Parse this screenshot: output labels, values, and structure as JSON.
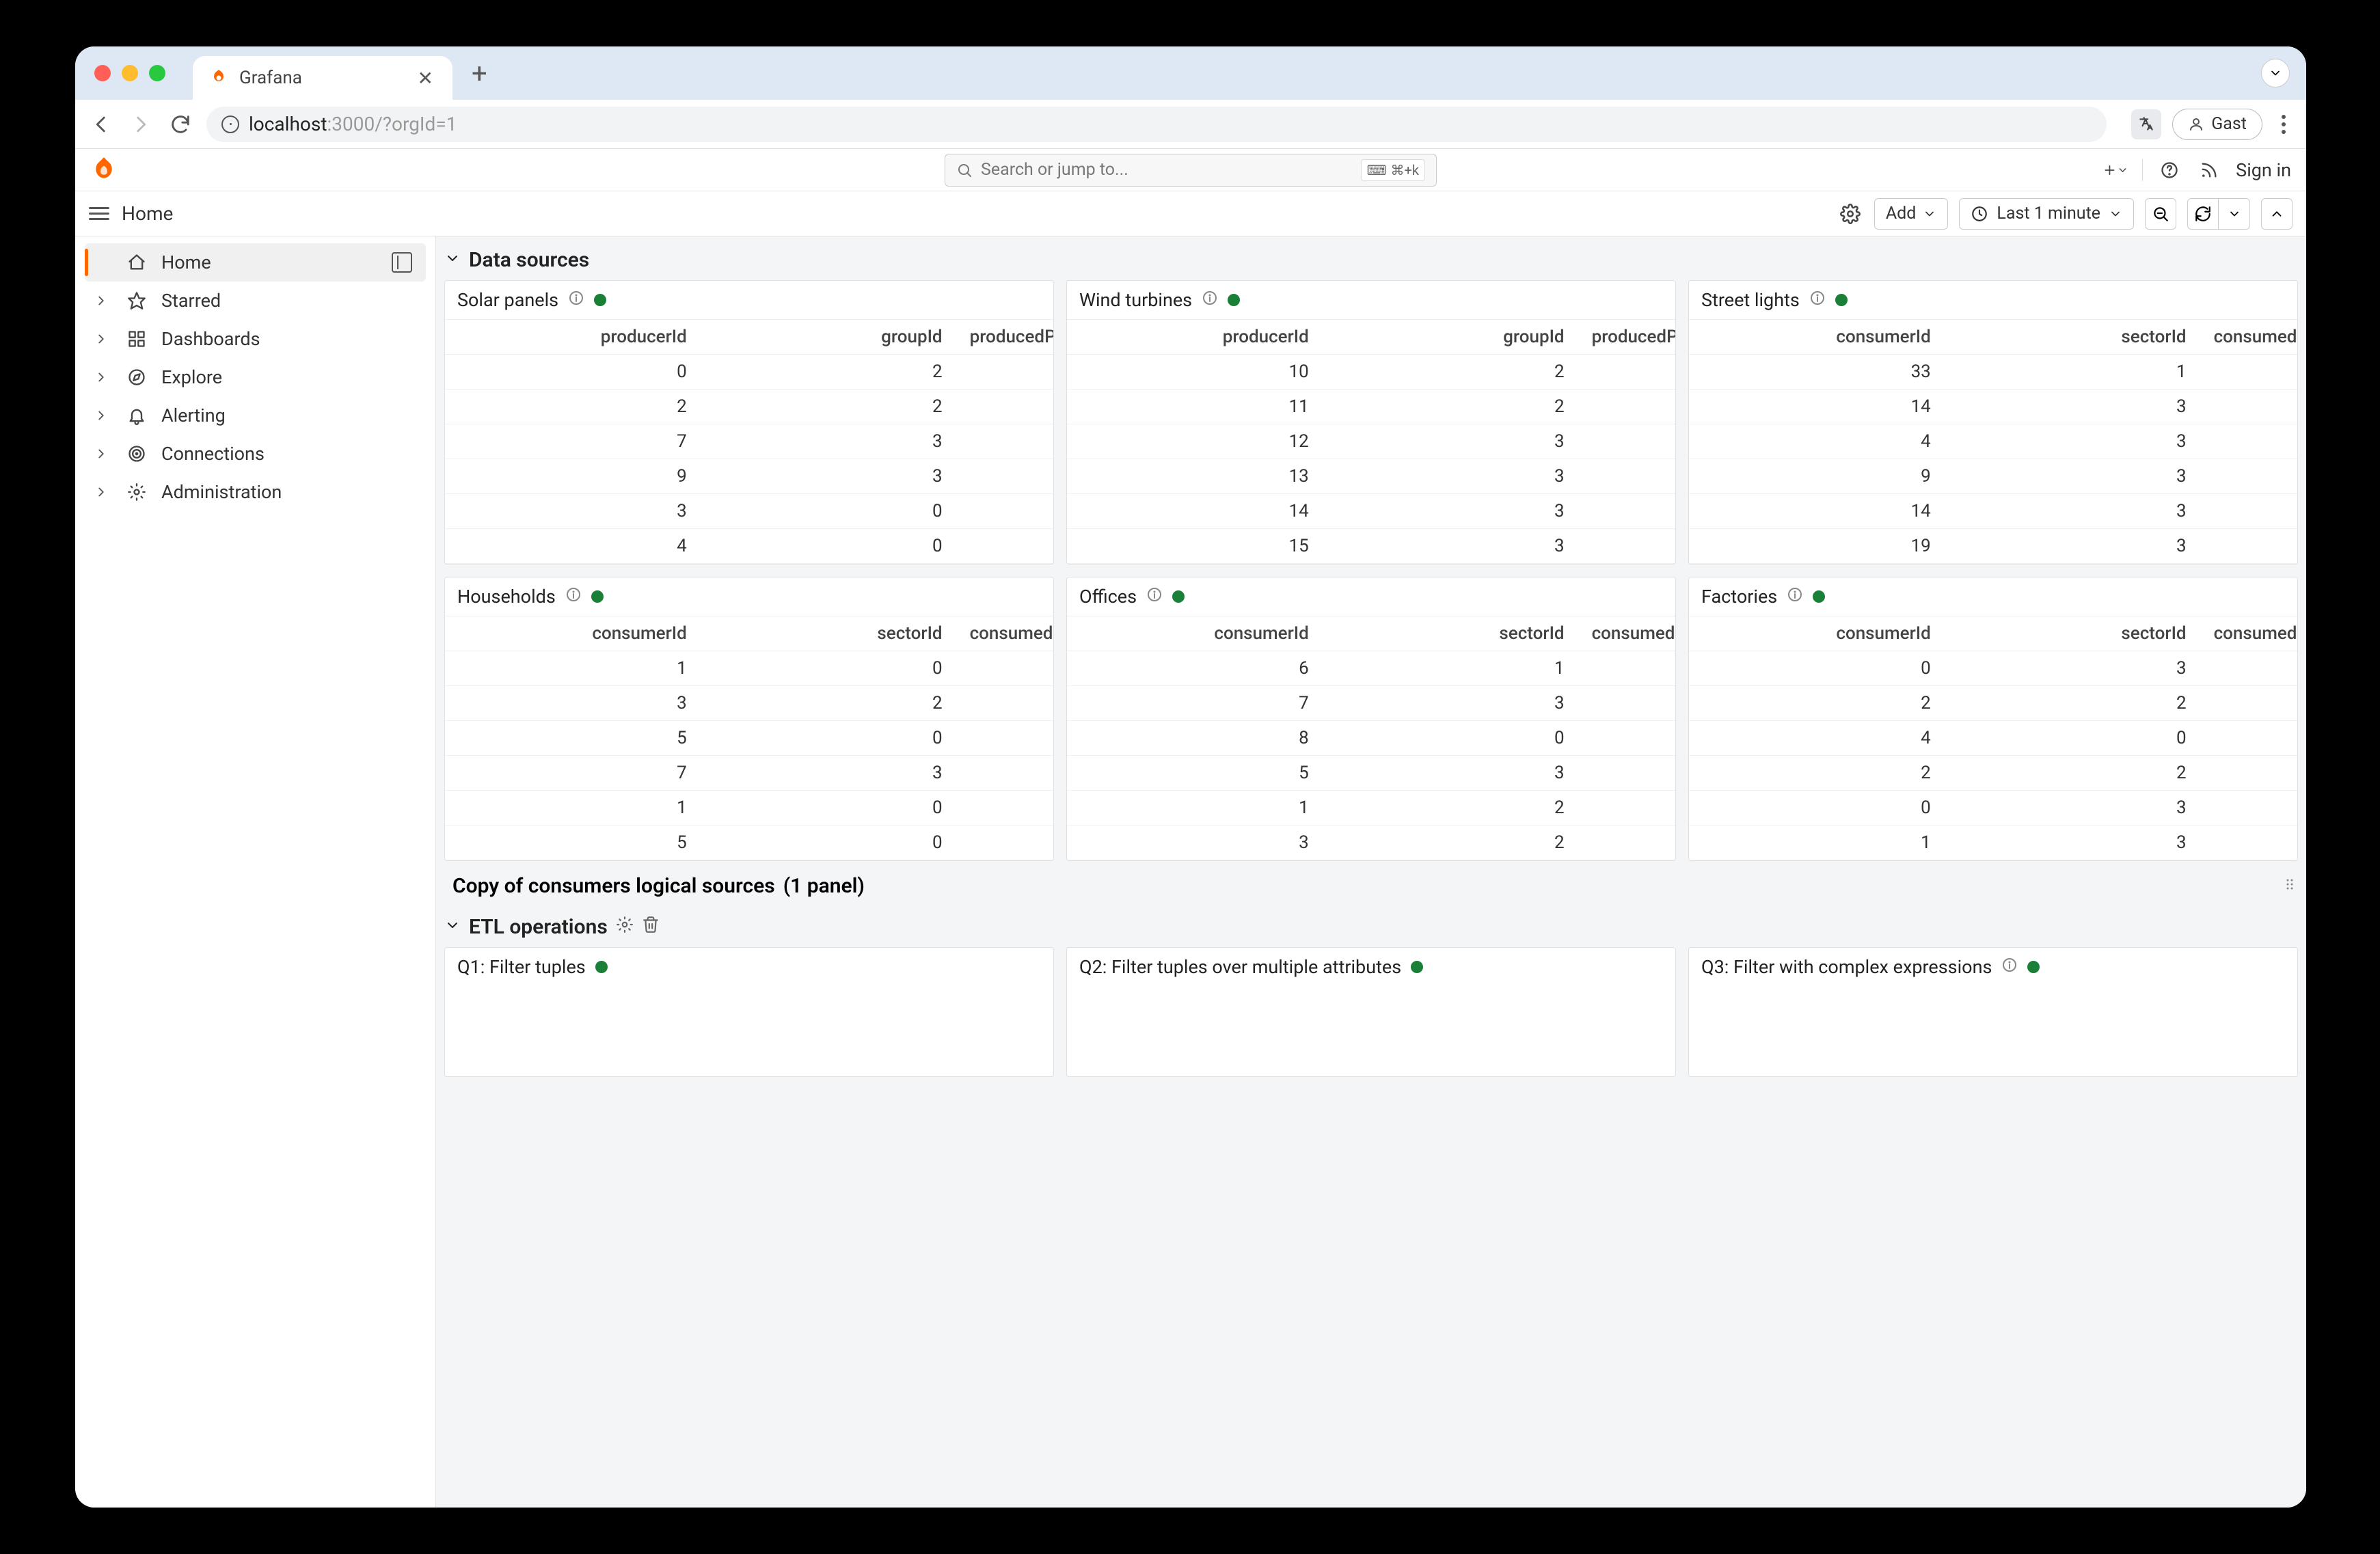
{
  "browser": {
    "tab_title": "Grafana",
    "url_host": "localhost",
    "url_rest": ":3000/?orgId=1",
    "profile_label": "Gast"
  },
  "grafana_top": {
    "search_placeholder": "Search or jump to...",
    "kbd1_icon": "⌨",
    "kbd2": "⌘+k",
    "signin": "Sign in"
  },
  "sub_toolbar": {
    "breadcrumb": "Home",
    "add_label": "Add",
    "time_label": "Last 1 minute"
  },
  "sidebar": {
    "items": [
      {
        "label": "Home",
        "icon": "home",
        "active": true,
        "expandable": false,
        "collapse_btn": true
      },
      {
        "label": "Starred",
        "icon": "star",
        "active": false,
        "expandable": true
      },
      {
        "label": "Dashboards",
        "icon": "grid",
        "active": false,
        "expandable": true
      },
      {
        "label": "Explore",
        "icon": "compass",
        "active": false,
        "expandable": true
      },
      {
        "label": "Alerting",
        "icon": "bell",
        "active": false,
        "expandable": true
      },
      {
        "label": "Connections",
        "icon": "target",
        "active": false,
        "expandable": true
      },
      {
        "label": "Administration",
        "icon": "gear",
        "active": false,
        "expandable": true
      }
    ]
  },
  "rows": {
    "data_sources_title": "Data sources",
    "copy_row_title": "Copy of consumers logical sources",
    "copy_row_sub": "(1 panel)",
    "etl_title": "ETL operations"
  },
  "panels": [
    {
      "title": "Solar panels",
      "columns": [
        "producerId",
        "groupId",
        "producedP"
      ],
      "rows": [
        [
          "0",
          "2",
          ""
        ],
        [
          "2",
          "2",
          ""
        ],
        [
          "7",
          "3",
          ""
        ],
        [
          "9",
          "3",
          ""
        ],
        [
          "3",
          "0",
          ""
        ],
        [
          "4",
          "0",
          ""
        ]
      ]
    },
    {
      "title": "Wind turbines",
      "columns": [
        "producerId",
        "groupId",
        "producedP"
      ],
      "rows": [
        [
          "10",
          "2",
          ""
        ],
        [
          "11",
          "2",
          ""
        ],
        [
          "12",
          "3",
          ""
        ],
        [
          "13",
          "3",
          ""
        ],
        [
          "14",
          "3",
          ""
        ],
        [
          "15",
          "3",
          ""
        ]
      ]
    },
    {
      "title": "Street lights",
      "columns": [
        "consumerId",
        "sectorId",
        "consumedP"
      ],
      "rows": [
        [
          "33",
          "1",
          ""
        ],
        [
          "14",
          "3",
          ""
        ],
        [
          "4",
          "3",
          ""
        ],
        [
          "9",
          "3",
          ""
        ],
        [
          "14",
          "3",
          ""
        ],
        [
          "19",
          "3",
          ""
        ]
      ]
    },
    {
      "title": "Households",
      "columns": [
        "consumerId",
        "sectorId",
        "consumedP"
      ],
      "rows": [
        [
          "1",
          "0",
          ""
        ],
        [
          "3",
          "2",
          ""
        ],
        [
          "5",
          "0",
          ""
        ],
        [
          "7",
          "3",
          ""
        ],
        [
          "1",
          "0",
          ""
        ],
        [
          "5",
          "0",
          ""
        ]
      ]
    },
    {
      "title": "Offices",
      "columns": [
        "consumerId",
        "sectorId",
        "consumedP"
      ],
      "rows": [
        [
          "6",
          "1",
          ""
        ],
        [
          "7",
          "3",
          ""
        ],
        [
          "8",
          "0",
          ""
        ],
        [
          "5",
          "3",
          ""
        ],
        [
          "1",
          "2",
          ""
        ],
        [
          "3",
          "2",
          ""
        ]
      ]
    },
    {
      "title": "Factories",
      "columns": [
        "consumerId",
        "sectorId",
        "consumedP"
      ],
      "rows": [
        [
          "0",
          "3",
          ""
        ],
        [
          "2",
          "2",
          ""
        ],
        [
          "4",
          "0",
          ""
        ],
        [
          "2",
          "2",
          ""
        ],
        [
          "0",
          "3",
          ""
        ],
        [
          "1",
          "3",
          ""
        ]
      ]
    }
  ],
  "etl_panels": [
    {
      "title": "Q1: Filter tuples"
    },
    {
      "title": "Q2: Filter tuples over multiple attributes"
    },
    {
      "title": "Q3: Filter with complex expressions",
      "has_info": true
    }
  ]
}
